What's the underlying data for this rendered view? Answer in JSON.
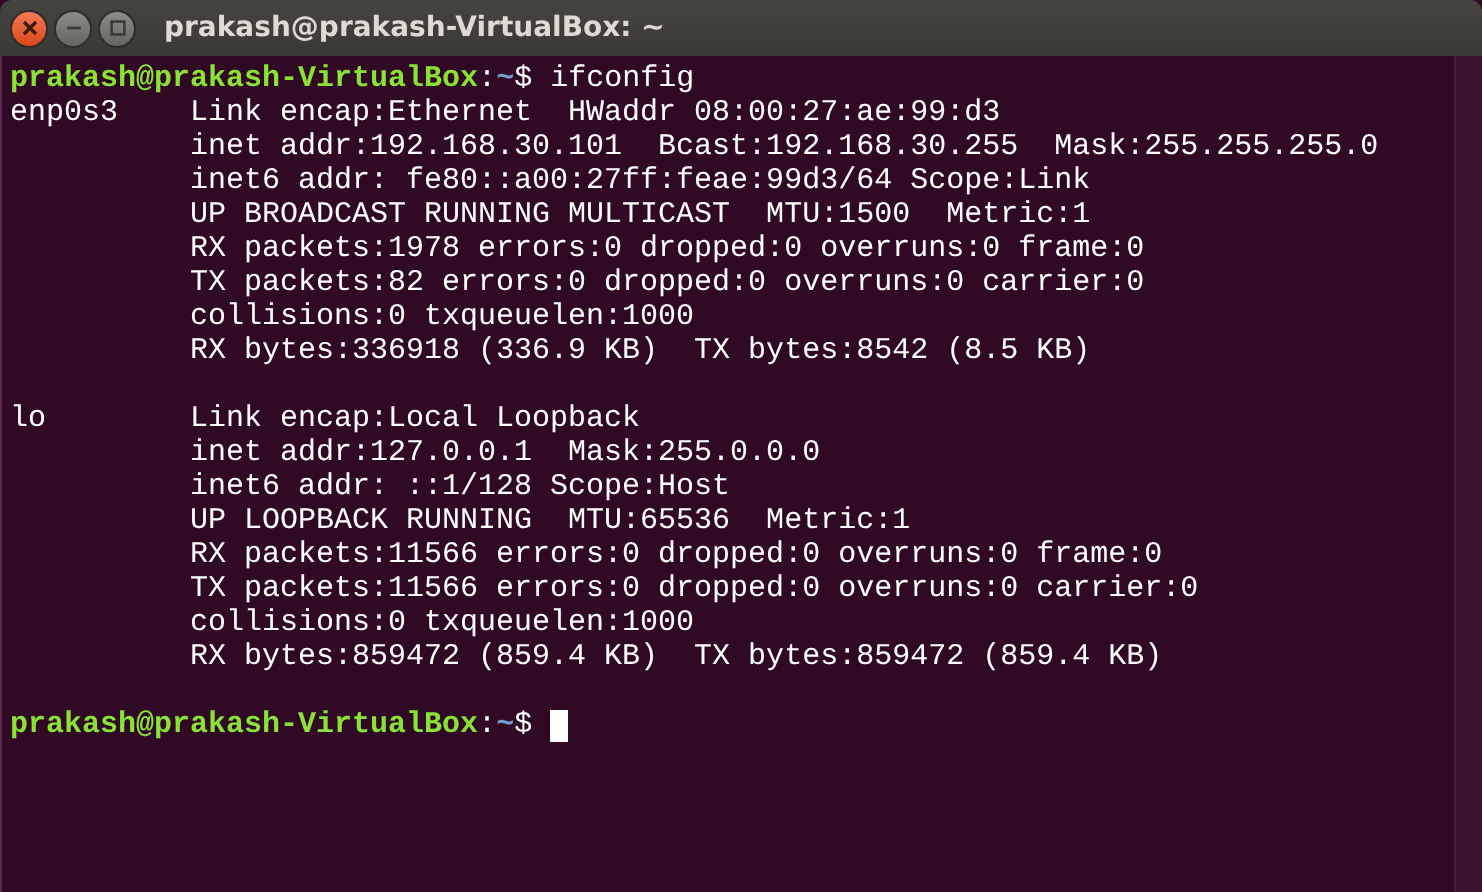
{
  "window": {
    "title": "prakash@prakash-VirtualBox: ~"
  },
  "terminal": {
    "lines": [
      {
        "kind": "prompt",
        "user_host": "prakash@prakash-VirtualBox",
        "separator": ":",
        "path": "~",
        "symbol": "$",
        "command": "ifconfig"
      },
      {
        "kind": "output",
        "text": "enp0s3    Link encap:Ethernet  HWaddr 08:00:27:ae:99:d3"
      },
      {
        "kind": "output",
        "text": "          inet addr:192.168.30.101  Bcast:192.168.30.255  Mask:255.255.255.0"
      },
      {
        "kind": "output",
        "text": "          inet6 addr: fe80::a00:27ff:feae:99d3/64 Scope:Link"
      },
      {
        "kind": "output",
        "text": "          UP BROADCAST RUNNING MULTICAST  MTU:1500  Metric:1"
      },
      {
        "kind": "output",
        "text": "          RX packets:1978 errors:0 dropped:0 overruns:0 frame:0"
      },
      {
        "kind": "output",
        "text": "          TX packets:82 errors:0 dropped:0 overruns:0 carrier:0"
      },
      {
        "kind": "output",
        "text": "          collisions:0 txqueuelen:1000"
      },
      {
        "kind": "output",
        "text": "          RX bytes:336918 (336.9 KB)  TX bytes:8542 (8.5 KB)"
      },
      {
        "kind": "blank"
      },
      {
        "kind": "output",
        "text": "lo        Link encap:Local Loopback"
      },
      {
        "kind": "output",
        "text": "          inet addr:127.0.0.1  Mask:255.0.0.0"
      },
      {
        "kind": "output",
        "text": "          inet6 addr: ::1/128 Scope:Host"
      },
      {
        "kind": "output",
        "text": "          UP LOOPBACK RUNNING  MTU:65536  Metric:1"
      },
      {
        "kind": "output",
        "text": "          RX packets:11566 errors:0 dropped:0 overruns:0 frame:0"
      },
      {
        "kind": "output",
        "text": "          TX packets:11566 errors:0 dropped:0 overruns:0 carrier:0"
      },
      {
        "kind": "output",
        "text": "          collisions:0 txqueuelen:1000"
      },
      {
        "kind": "output",
        "text": "          RX bytes:859472 (859.4 KB)  TX bytes:859472 (859.4 KB)"
      },
      {
        "kind": "blank"
      },
      {
        "kind": "prompt",
        "user_host": "prakash@prakash-VirtualBox",
        "separator": ":",
        "path": "~",
        "symbol": "$",
        "cursor": true
      }
    ]
  }
}
